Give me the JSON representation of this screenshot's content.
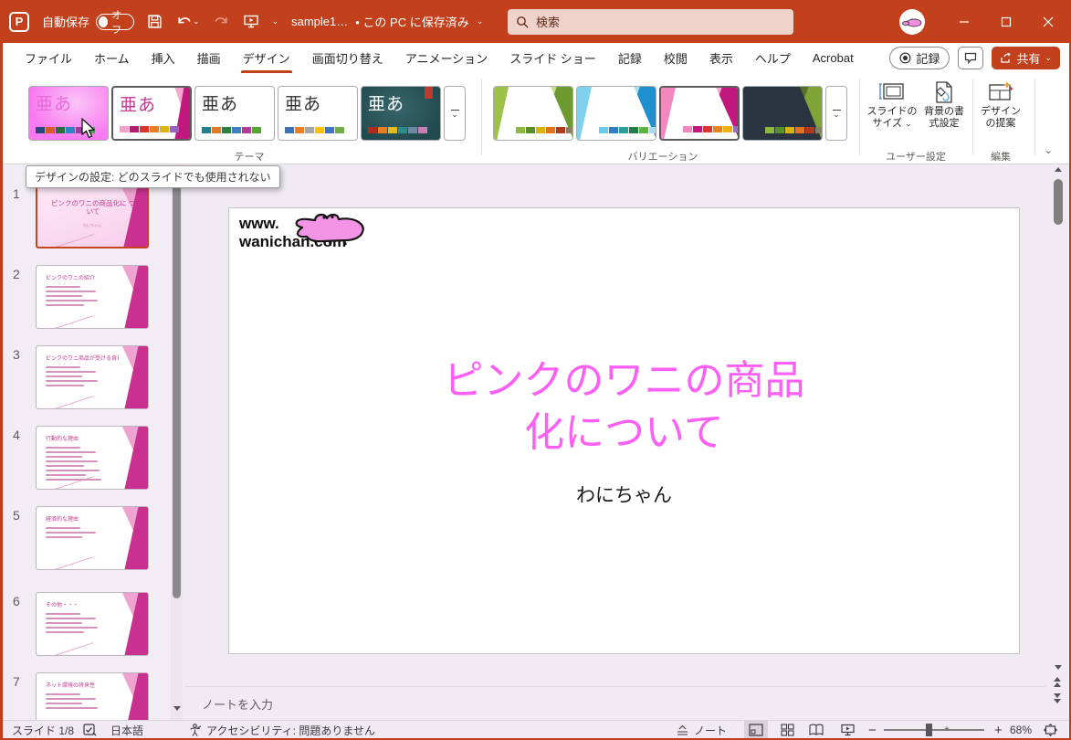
{
  "window": {
    "autosave_label": "自動保存",
    "autosave_state": "オフ",
    "filename": "sample1…",
    "save_status": "• この PC に保存済み",
    "search_placeholder": "検索"
  },
  "tabs": [
    "ファイル",
    "ホーム",
    "挿入",
    "描画",
    "デザイン",
    "画面切り替え",
    "アニメーション",
    "スライド ショー",
    "記録",
    "校閲",
    "表示",
    "ヘルプ",
    "Acrobat"
  ],
  "active_tab": "デザイン",
  "ribbon": {
    "record_label": "記録",
    "share_label": "共有",
    "themes": {
      "label": "テーマ",
      "items": [
        {
          "name": "theme-pink",
          "text": "亜あ",
          "swatches": [
            "#27477E",
            "#D95B2B",
            "#316B3D",
            "#2E86C5",
            "#9C3F9C",
            "#47A547"
          ]
        },
        {
          "name": "theme-wisp",
          "text": "亜あ",
          "swatches": [
            "#F2A0C8",
            "#B01E6E",
            "#D3362B",
            "#E87E20",
            "#DFB40E",
            "#9465BD"
          ]
        },
        {
          "name": "theme-3",
          "text": "亜あ",
          "swatches": [
            "#20808F",
            "#E07B28",
            "#2F7F3F",
            "#3F7FBF",
            "#B5389B",
            "#55A630"
          ]
        },
        {
          "name": "theme-4",
          "text": "亜あ",
          "swatches": [
            "#3F71B5",
            "#EE7F23",
            "#A5A5A5",
            "#FFC000",
            "#4472C4",
            "#70AD47"
          ]
        },
        {
          "name": "theme-5",
          "text": "亜あ",
          "swatches": [
            "#B02A1E",
            "#E67E22",
            "#E6B91E",
            "#2E8B8B",
            "#6B8BA4",
            "#C97FB5"
          ]
        }
      ]
    },
    "variations": {
      "label": "バリエーション",
      "items": [
        {
          "name": "variation-green",
          "swatches": [
            "#8CBA3E",
            "#5A8F29",
            "#D9B310",
            "#E0731D",
            "#B03A1E",
            "#8C8062"
          ]
        },
        {
          "name": "variation-blue",
          "swatches": [
            "#6EC9EA",
            "#2E7CC4",
            "#2AA198",
            "#237D4B",
            "#5AB43E",
            "#A8DCF0"
          ]
        },
        {
          "name": "variation-pink",
          "swatches": [
            "#F288BE",
            "#C2187E",
            "#D3382A",
            "#E8821F",
            "#EFB111",
            "#A06CC4"
          ]
        },
        {
          "name": "variation-dark",
          "swatches": [
            "#8CBA3E",
            "#5A8F29",
            "#D9B310",
            "#E0731D",
            "#B03A1E",
            "#8C8062"
          ]
        }
      ]
    },
    "slide_size": {
      "line1": "スライドの",
      "line2": "サイズ"
    },
    "background_format": {
      "line1": "背景の書",
      "line2": "式設定"
    },
    "design_ideas": {
      "line1": "デザイン",
      "line2": "の提案"
    },
    "group_user": "ユーザー設定",
    "group_edit": "編集"
  },
  "tooltip": {
    "text": "デザインの設定: どのスライドでも使用されない"
  },
  "thumbnails": [
    {
      "num": "1",
      "type": "title",
      "selected": true,
      "title": "ピンクのワニの商品化に ついて",
      "subtitle": "わにちゃん",
      "bullets": 0
    },
    {
      "num": "2",
      "type": "content",
      "selected": false,
      "title": "ピンクのワニの紹介",
      "bullets": 5
    },
    {
      "num": "3",
      "type": "content",
      "selected": false,
      "title": "ピンクのワニ商品が受ける背景",
      "bullets": 5
    },
    {
      "num": "4",
      "type": "content",
      "selected": false,
      "title": "行動的な理由",
      "bullets": 8
    },
    {
      "num": "5",
      "type": "content",
      "selected": false,
      "title": "経済的な理由",
      "bullets": 3
    },
    {
      "num": "6",
      "type": "content",
      "selected": false,
      "title": "その他・・・",
      "bullets": 5
    },
    {
      "num": "7",
      "type": "content",
      "selected": false,
      "title": "ネット環境の将来性",
      "bullets": 4
    }
  ],
  "slide": {
    "logo_line1": "www.",
    "logo_line2": "wanichan.com",
    "title_line1": "ピンクのワニの商品",
    "title_line2": "化について",
    "subtitle": "わにちゃん",
    "title_color": "#fc5ff3"
  },
  "notes": {
    "placeholder": "ノートを入力"
  },
  "statusbar": {
    "slide_indicator": "スライド 1/8",
    "language": "日本語",
    "accessibility": "アクセシビリティ: 問題ありません",
    "notes_label": "ノート",
    "zoom_level": "68%"
  },
  "colors": {
    "accent": "#C2401C",
    "title_pink": "#FC5FF3",
    "variation_magenta": "#C2187E"
  }
}
